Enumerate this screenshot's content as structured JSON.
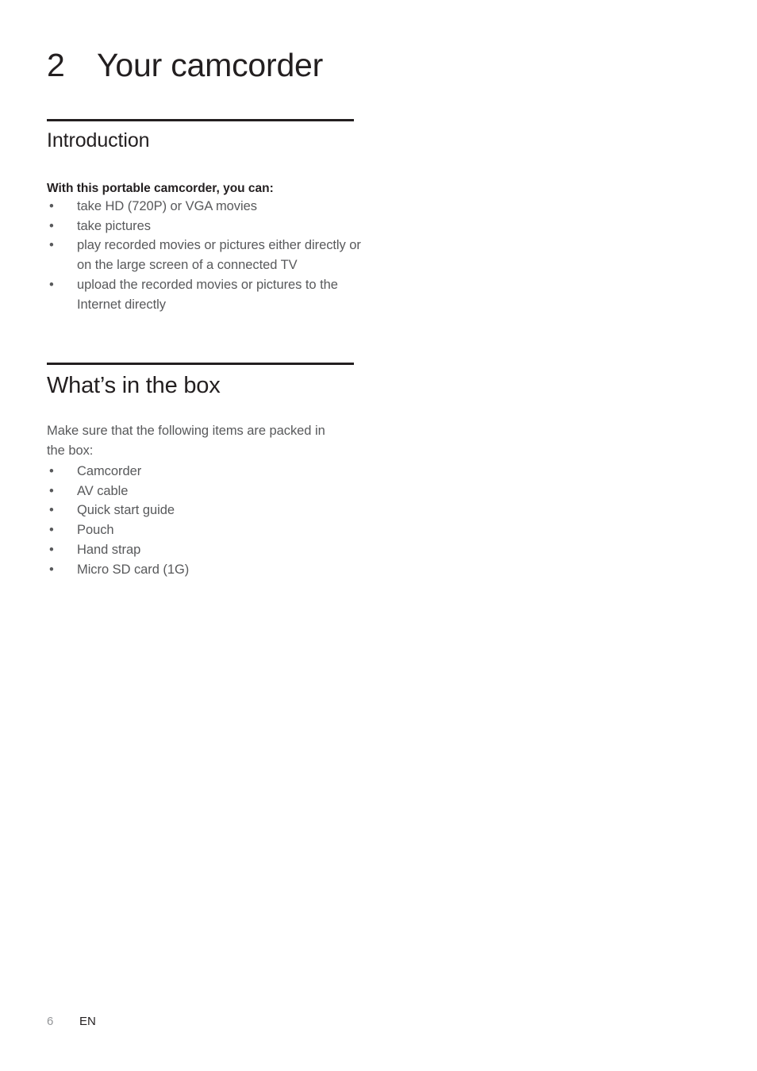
{
  "document": {
    "chapter": {
      "number": "2",
      "title": "Your camcorder"
    },
    "sections": [
      {
        "heading": "Introduction",
        "lead": "With this portable camcorder, you can:",
        "items": [
          "take HD (720P) or VGA movies",
          "take pictures",
          "play recorded movies or pictures either directly or on the large screen of a connected TV",
          "upload the recorded movies or pictures to the Internet directly"
        ]
      },
      {
        "heading": "What’s in the box",
        "paragraph": "Make sure that the following items are packed in the box:",
        "items": [
          "Camcorder",
          "AV cable",
          "Quick start guide",
          "Pouch",
          "Hand strap",
          "Micro SD card (1G)"
        ]
      }
    ],
    "footer": {
      "page_number": "6",
      "language": "EN"
    },
    "bullet_glyph": "•",
    "colors": {
      "heading": "#231f20",
      "body": "#58595b",
      "rule": "#231f20",
      "page_number": "#939598",
      "background": "#ffffff"
    }
  }
}
